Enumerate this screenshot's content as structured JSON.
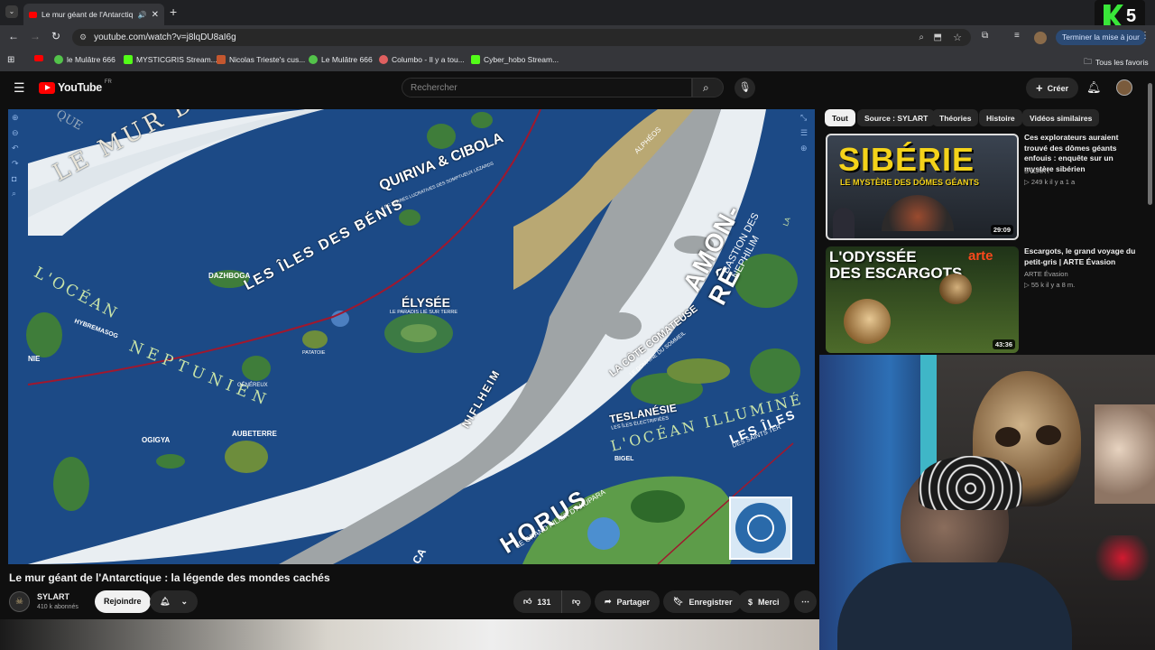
{
  "browser": {
    "tab_title": "Le mur géant de l'Antarctiq",
    "url": "youtube.com/watch?v=j8lqDU8aI6g",
    "update_button": "Terminer la mise à jour",
    "bookmarks": [
      "le Mulâtre 666",
      "MYSTICGRIS Stream...",
      "Nicolas Trieste's cus...",
      "Le Mulâtre 666",
      "Columbo - Il y a tou...",
      "Cyber_hobo Stream..."
    ],
    "all_favorites": "Tous les favoris",
    "brand_badge": "5"
  },
  "youtube": {
    "logo_text": "YouTube",
    "region": "FR",
    "search_placeholder": "Rechercher",
    "create_label": "Créer",
    "chips": [
      "Tout",
      "Source : SYLART",
      "Théories",
      "Histoire",
      "Vidéos similaires"
    ],
    "video": {
      "title": "Le mur géant de l'Antarctique : la légende des mondes cachés",
      "channel": "SYLART",
      "subscribers": "410 k abonnés",
      "join_label": "Rejoindre",
      "likes": "131",
      "share_label": "Partager",
      "save_label": "Enregistrer",
      "thanks_label": "Merci"
    },
    "map_labels": {
      "wall": "LE MUR DE GLACE",
      "quiriva": "QUIRIVA & CIBOLA",
      "quiriva_sub": "LES TERRES LUCRATIVES DES SOMPTUEUX LEZARDS",
      "benis": "LES ÎLES DES BÉNIS",
      "ocean_n1": "L'OCÉAN",
      "ocean_n2": "NEPTUNIEN",
      "elysee": "ÉLYSÉE",
      "elysee_sub": "LE PARADIS LIÉ SUR TERRE",
      "amon": "AMON-RÊ",
      "amon_sub": "BASTION DES NEPHILIM",
      "alpheos": "ALPHÉOS",
      "dazhboga": "DAZHBOGA",
      "hybremasog": "HYBREMASOG",
      "ogigya": "OGIGYA",
      "aubeterre": "AUBETERRE",
      "genereux": "GÉNÉREUX",
      "patatoie": "PATATOIE",
      "niflheim": "NIFLHEIM",
      "cote": "LA CÔTE COMATEUSE",
      "cote_sub": "LE DOMAINE DU SOMMEIL",
      "teslanesie": "TESLANÉSIE",
      "teslanesie_sub": "LES ÎLES ÉLECTRIFIÉES",
      "ocean_i": "L'OCÉAN ILLUMINÉ",
      "iles": "LES ÎLES",
      "iles_sub": "DES SAINTS TER",
      "horus": "HORUS",
      "horus_sub": "LE GRAND PILIER D'AKUPARA",
      "bigel": "BIGEL",
      "que": "QUE",
      "nie": "NIE",
      "ca": "CA",
      "la": "LA"
    },
    "recommendations": [
      {
        "thumb_text1": "SIBÉRIE",
        "thumb_text2": "LE MYSTÈRE DES DÔMES GÉANTS",
        "duration": "29:09",
        "title": "Ces explorateurs auraient trouvé des dômes géants enfouis : enquête sur un mystère sibérien",
        "channel": "SYLART",
        "meta": "249 k   il y a 1 a"
      },
      {
        "thumb_text1": "L'ODYSSÉE",
        "thumb_text2": "DES ESCARGOTS",
        "thumb_brand": "arte",
        "duration": "43:36",
        "title": "Escargots, le grand voyage du petit-gris | ARTE Évasion",
        "channel": "ARTE Évasion",
        "meta": "55 k   il y a 8 m."
      }
    ]
  },
  "colors": {
    "yt_red": "#ff0000",
    "bg": "#0f0f0f",
    "ocean": "#1d4f8f",
    "land": "#3f7d3a",
    "ice": "#e9eef2"
  }
}
